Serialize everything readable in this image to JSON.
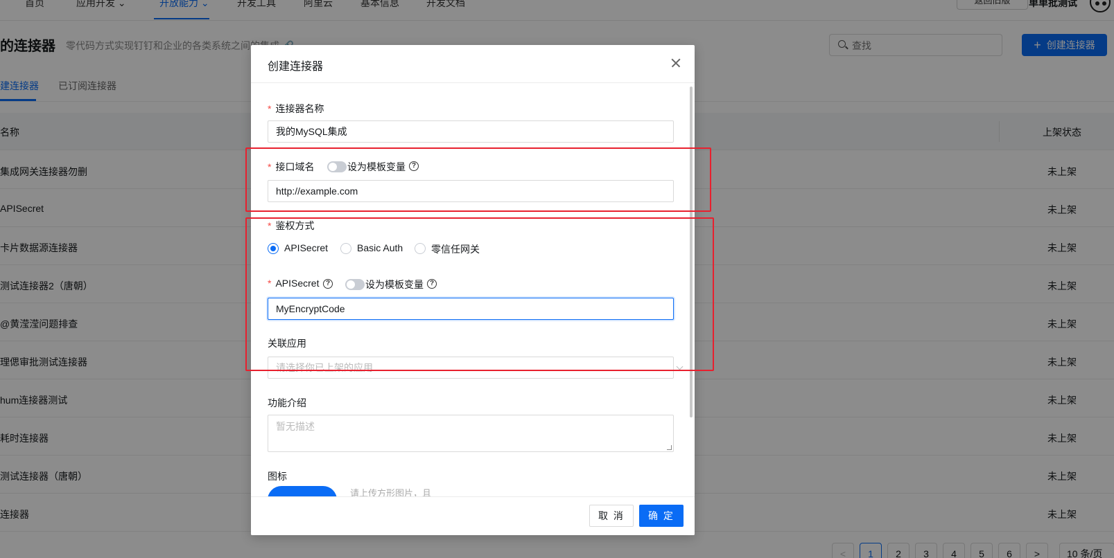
{
  "topnav": {
    "items": [
      "首页",
      "应用开发 ⌄",
      "开放能力 ⌄",
      "开发工具",
      "阿里云",
      "基本信息",
      "开发文档"
    ],
    "return_button": "返回旧版",
    "user_name": "单单批测试"
  },
  "page": {
    "title": "的连接器",
    "subtitle": "零代码方式实现钉钉和企业的各类系统之间的集成",
    "search_placeholder": "查找",
    "create_button": "创建连接器"
  },
  "tabs": [
    "建连接器",
    "已订阅连接器"
  ],
  "table": {
    "headers": {
      "name": "名称",
      "status": "上架状态"
    },
    "rows": [
      {
        "name": "集成网关连接器勿删",
        "status": "未上架"
      },
      {
        "name": "APISecret",
        "status": "未上架"
      },
      {
        "name": "卡片数据源连接器",
        "status": "未上架"
      },
      {
        "name": "测试连接器2（唐朝）",
        "status": "未上架"
      },
      {
        "name": "@黄滢滢问题排查",
        "status": "未上架"
      },
      {
        "name": "理偲审批测试连接器",
        "status": "未上架"
      },
      {
        "name": "hum连接器测试",
        "status": "未上架"
      },
      {
        "name": "耗时连接器",
        "status": "未上架"
      },
      {
        "name": "测试连接器（唐朝）",
        "status": "未上架"
      },
      {
        "name": "连接器",
        "status": "未上架"
      }
    ]
  },
  "pagination": {
    "prev": "<",
    "pages": [
      "1",
      "2",
      "3",
      "4",
      "5",
      "6"
    ],
    "current": "1",
    "next": ">",
    "page_size": "10 条/页"
  },
  "modal": {
    "title": "创建连接器",
    "connector_name": {
      "label": "连接器名称",
      "value": "我的MySQL集成"
    },
    "domain": {
      "label": "接口域名",
      "toggle_label": "设为模板变量",
      "value": "http://example.com"
    },
    "auth": {
      "label": "鉴权方式",
      "options": [
        "APISecret",
        "Basic Auth",
        "零信任网关"
      ],
      "selected": "APISecret"
    },
    "apisecret": {
      "label": "APISecret",
      "toggle_label": "设为模板变量",
      "value": "MyEncryptCode"
    },
    "linked_app": {
      "label": "关联应用",
      "placeholder": "请选择你已上架的应用"
    },
    "description": {
      "label": "功能介绍",
      "placeholder": "暂无描述"
    },
    "icon": {
      "label": "图标",
      "hint": "请上传方形图片，且"
    },
    "cancel_button": "取 消",
    "ok_button": "确 定"
  },
  "colors": {
    "primary": "#0a6cf5",
    "required": "#f54a45",
    "annotation": "#e8202e"
  }
}
